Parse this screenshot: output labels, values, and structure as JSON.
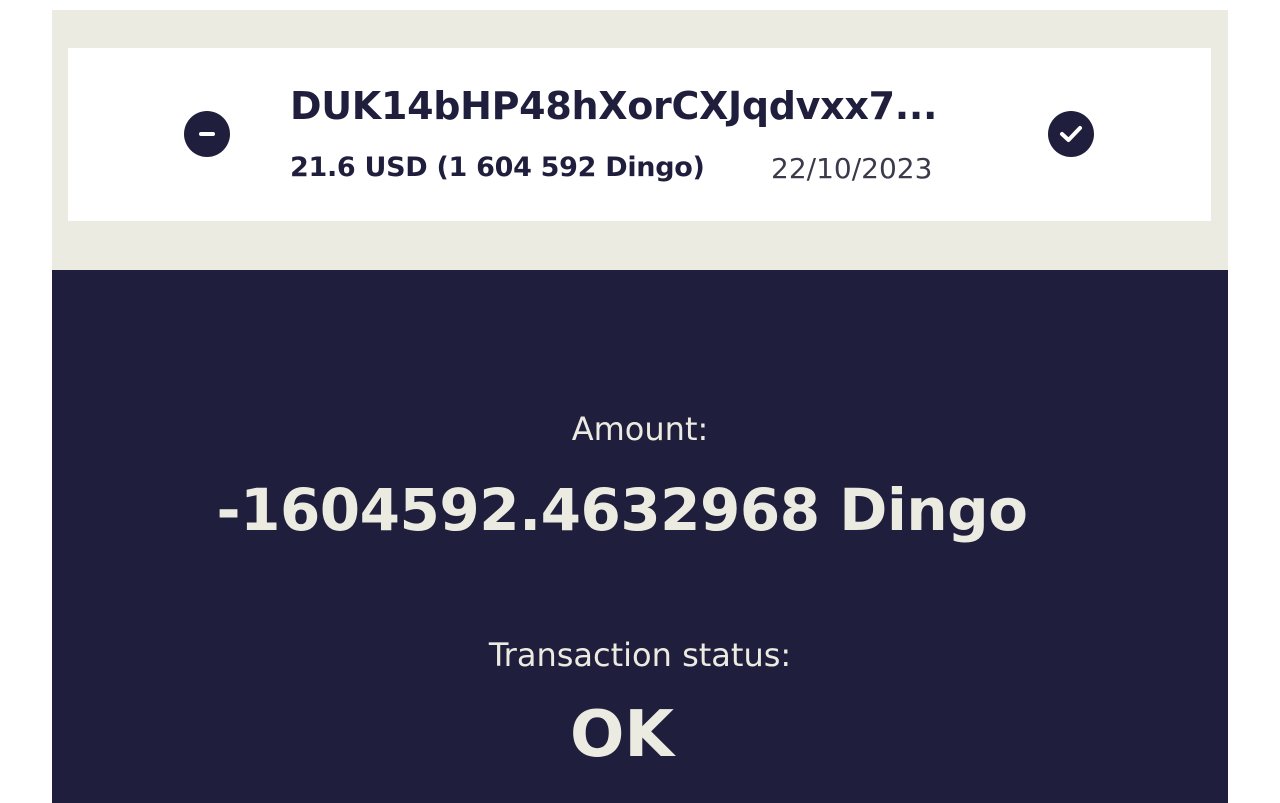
{
  "transaction": {
    "address": "DUK14bHP48hXorCXJqdvxx7...",
    "usd_amount": "21.6 USD (1 604 592 Dingo)",
    "date": "22/10/2023",
    "direction_icon": "minus-circle-icon",
    "status_icon": "check-circle-icon"
  },
  "details": {
    "amount_label": "Amount:",
    "amount_value": "-1604592.4632968 Dingo",
    "status_label": "Transaction status:",
    "status_value": "OK"
  },
  "colors": {
    "navy": "#1f1e3c",
    "cream": "#ecebe1",
    "white": "#ffffff"
  }
}
